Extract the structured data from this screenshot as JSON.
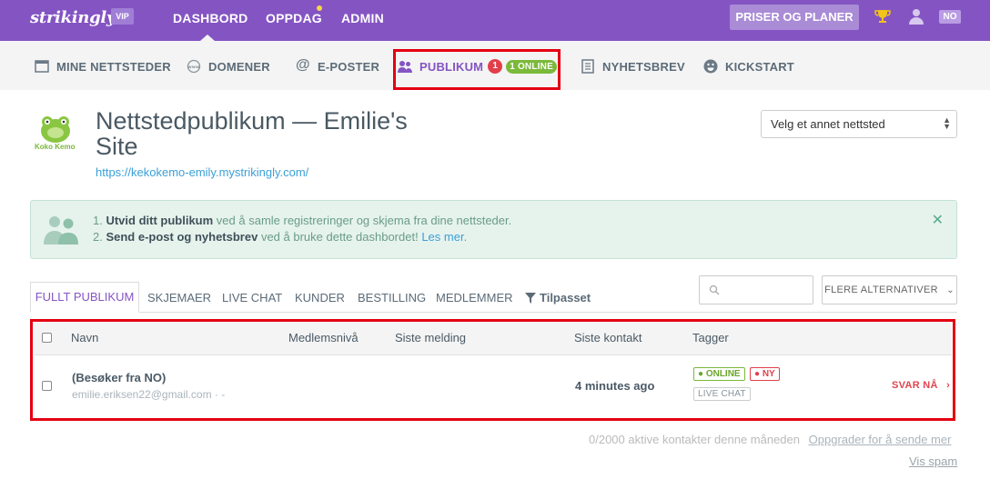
{
  "topbar": {
    "logo": "strikingly",
    "vip_badge": "VIP",
    "nav": [
      "DASHBORD",
      "OPPDAG",
      "ADMIN"
    ],
    "pricing_button": "PRISER OG PLANER",
    "language": "NO"
  },
  "subnav": {
    "items": [
      {
        "label": "MINE NETTSTEDER",
        "icon": "browser-window-icon"
      },
      {
        "label": "DOMENER",
        "icon": "www-icon"
      },
      {
        "label": "E-POSTER",
        "icon": "at-icon"
      },
      {
        "label": "PUBLIKUM",
        "icon": "people-icon"
      },
      {
        "label": "NYHETSBREV",
        "icon": "newsletter-icon"
      },
      {
        "label": "KICKSTART",
        "icon": "smiley-icon"
      }
    ],
    "publikum_count": "1",
    "online_badge": "1 ONLINE"
  },
  "header": {
    "logo_text": "Koko Kemo",
    "title": "Nettstedpublikum — Emilie's Site",
    "url": "https://kekokemo-emily.mystrikingly.com/",
    "site_select": "Velg et annet nettsted"
  },
  "alert": {
    "line1_num": "1.",
    "line1_bold": "Utvid ditt publikum",
    "line1_rest": " ved å samle registreringer og skjema fra dine nettsteder.",
    "line2_num": "2.",
    "line2_bold": "Send e-post og nyhetsbrev",
    "line2_rest": " ved å bruke dette dashbordet!",
    "line2_link": "Les mer."
  },
  "tabs": {
    "active": "FULLT PUBLIKUM",
    "items": [
      "SKJEMAER",
      "LIVE CHAT",
      "KUNDER",
      "BESTILLING",
      "MEDLEMMER"
    ],
    "custom": "Tilpasset",
    "more_button": "FLERE ALTERNATIVER"
  },
  "table": {
    "headers": [
      "Navn",
      "Medlemsnivå",
      "Siste melding",
      "Siste kontakt",
      "Tagger"
    ],
    "rows": [
      {
        "name": "(Besøker fra NO)",
        "email": "emilie.eriksen22@gmail.com · -",
        "last_contact": "4 minutes ago",
        "tags": [
          "● ONLINE",
          "● NY",
          "LIVE CHAT"
        ],
        "action": "SVAR NÅ"
      }
    ]
  },
  "footer": {
    "active_contacts": "0/2000 aktive kontakter denne måneden",
    "upgrade_link": "Oppgrader for å sende mer",
    "spam_link": "Vis spam"
  },
  "colors": {
    "brand_purple": "#8454c3",
    "highlight_red": "#e40012",
    "online_green": "#7bb93a",
    "new_red": "#e33f4a"
  }
}
